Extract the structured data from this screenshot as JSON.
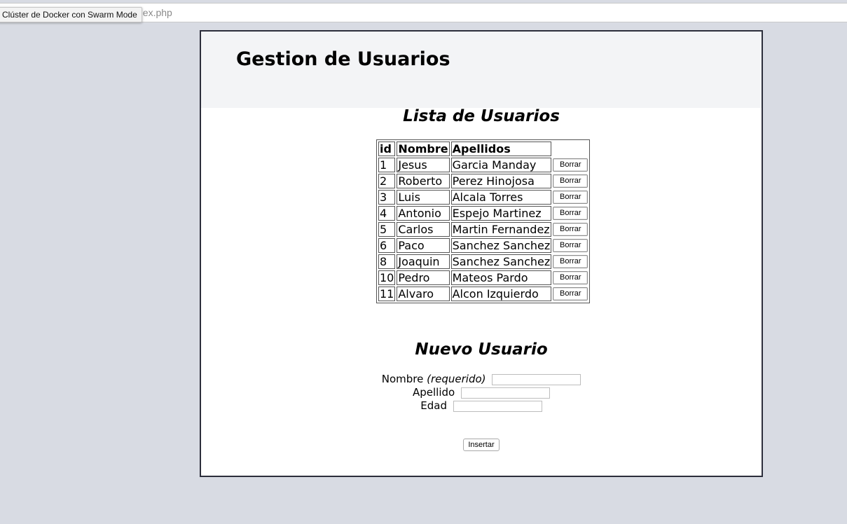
{
  "browser": {
    "tooltip": "Clúster de Docker con Swarm Mode",
    "url_tail": "dex.php"
  },
  "header": {
    "title": "Gestion de Usuarios"
  },
  "list": {
    "title": "Lista de Usuarios",
    "columns": [
      "id",
      "Nombre",
      "Apellidos"
    ],
    "delete_label": "Borrar",
    "rows": [
      {
        "id": "1",
        "nombre": "Jesus",
        "apellidos": "Garcia Manday"
      },
      {
        "id": "2",
        "nombre": "Roberto",
        "apellidos": "Perez Hinojosa"
      },
      {
        "id": "3",
        "nombre": "Luis",
        "apellidos": "Alcala Torres"
      },
      {
        "id": "4",
        "nombre": "Antonio",
        "apellidos": "Espejo Martinez"
      },
      {
        "id": "5",
        "nombre": "Carlos",
        "apellidos": "Martin Fernandez"
      },
      {
        "id": "6",
        "nombre": "Paco",
        "apellidos": "Sanchez Sanchez"
      },
      {
        "id": "8",
        "nombre": "Joaquin",
        "apellidos": "Sanchez Sanchez"
      },
      {
        "id": "10",
        "nombre": "Pedro",
        "apellidos": "Mateos Pardo"
      },
      {
        "id": "11",
        "nombre": "Alvaro",
        "apellidos": "Alcon Izquierdo"
      }
    ]
  },
  "form": {
    "title": "Nuevo Usuario",
    "nombre_label": "Nombre",
    "nombre_hint": "(requerido)",
    "nombre_value": "",
    "apellido_label": "Apellido",
    "apellido_value": "",
    "edad_label": "Edad",
    "edad_value": "",
    "submit_label": "Insertar"
  }
}
